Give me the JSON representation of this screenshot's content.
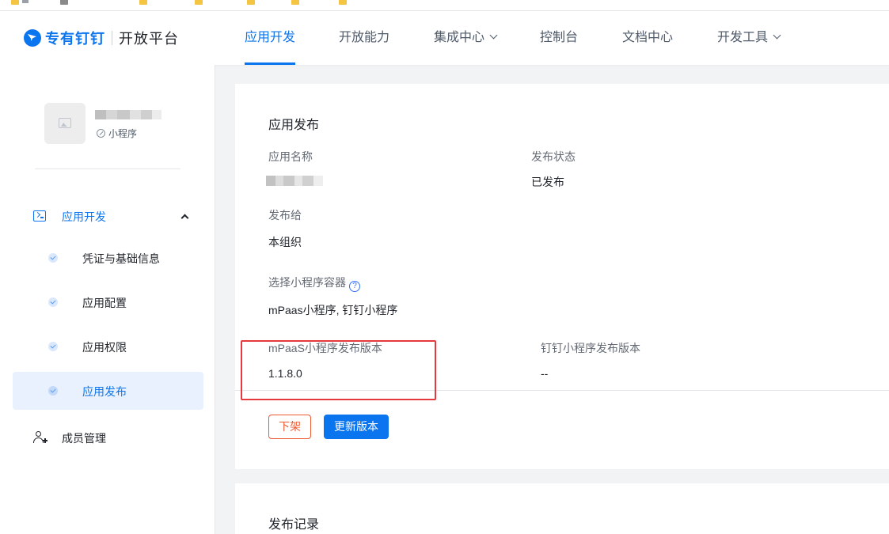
{
  "nav": {
    "brand": "专有钉钉",
    "platform": "开放平台",
    "items": [
      {
        "label": "应用开发",
        "active": true,
        "dropdown": false
      },
      {
        "label": "开放能力",
        "active": false,
        "dropdown": false
      },
      {
        "label": "集成中心",
        "active": false,
        "dropdown": true
      },
      {
        "label": "控制台",
        "active": false,
        "dropdown": false
      },
      {
        "label": "文档中心",
        "active": false,
        "dropdown": false
      },
      {
        "label": "开发工具",
        "active": false,
        "dropdown": true
      }
    ]
  },
  "sidebar": {
    "app_type": "小程序",
    "group": {
      "label": "应用开发",
      "expanded": true,
      "icon": "terminal-icon"
    },
    "items": [
      {
        "label": "凭证与基础信息",
        "active": false
      },
      {
        "label": "应用配置",
        "active": false
      },
      {
        "label": "应用权限",
        "active": false
      },
      {
        "label": "应用发布",
        "active": true
      }
    ],
    "member": {
      "label": "成员管理",
      "icon": "person-add-icon"
    }
  },
  "publish": {
    "title": "应用发布",
    "app_name_label": "应用名称",
    "status_label": "发布状态",
    "status_value": "已发布",
    "publish_to_label": "发布给",
    "publish_to_value": "本组织",
    "container_label": "选择小程序容器",
    "container_help": "?",
    "container_value": "mPaas小程序, 钉钉小程序",
    "mpaas_version_label": "mPaaS小程序发布版本",
    "mpaas_version_value": "1.1.8.0",
    "dingtalk_version_label": "钉钉小程序发布版本",
    "dingtalk_version_value": "--",
    "offline_button": "下架",
    "update_button": "更新版本"
  },
  "records": {
    "title": "发布记录"
  },
  "colors": {
    "primary": "#0b74ef",
    "danger_outline": "#ec5a31",
    "highlight": "#e5393d"
  }
}
